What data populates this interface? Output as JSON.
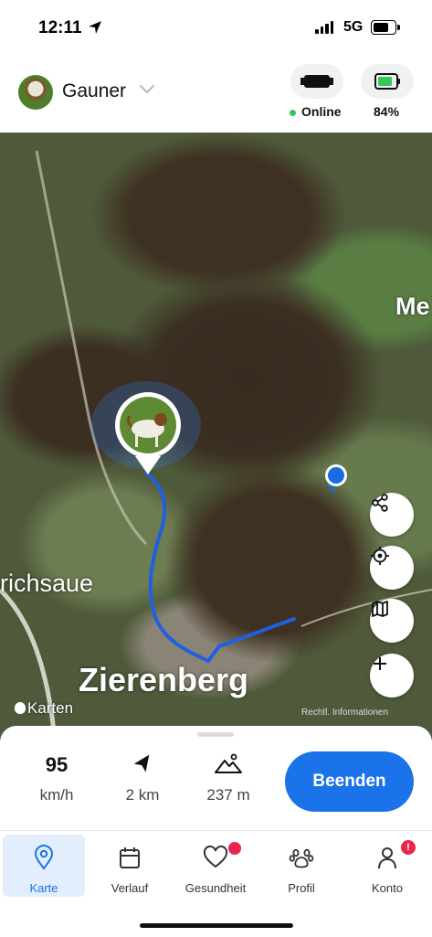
{
  "status_bar": {
    "time": "12:11",
    "network": "5G"
  },
  "header": {
    "dog_name": "Gauner",
    "devices": [
      {
        "icon": "tracker-icon",
        "label": "Online"
      },
      {
        "icon": "battery-icon",
        "label": "84%",
        "level": 0.84
      }
    ]
  },
  "map": {
    "place_labels": [
      "Me",
      "richsaue",
      "Zierenberg"
    ],
    "attribution": "Karten",
    "legal": "Rechtl. Informationen"
  },
  "stats": [
    {
      "value": "95",
      "label": "km/h"
    },
    {
      "value": "",
      "icon": "direction-icon",
      "label": "2 km"
    },
    {
      "value": "",
      "icon": "mountain-icon",
      "label": "237 m"
    }
  ],
  "end_button": "Beenden",
  "tabs": [
    {
      "label": "Karte",
      "icon": "map-pin-icon",
      "active": true
    },
    {
      "label": "Verlauf",
      "icon": "calendar-icon"
    },
    {
      "label": "Gesundheit",
      "icon": "heart-icon"
    },
    {
      "label": "Profil",
      "icon": "paw-icon"
    },
    {
      "label": "Konto",
      "icon": "person-icon",
      "badge": "!"
    }
  ],
  "colors": {
    "accent": "#1a73e8",
    "online": "#34c759",
    "alert": "#e6264d",
    "battery": "#34c759"
  }
}
